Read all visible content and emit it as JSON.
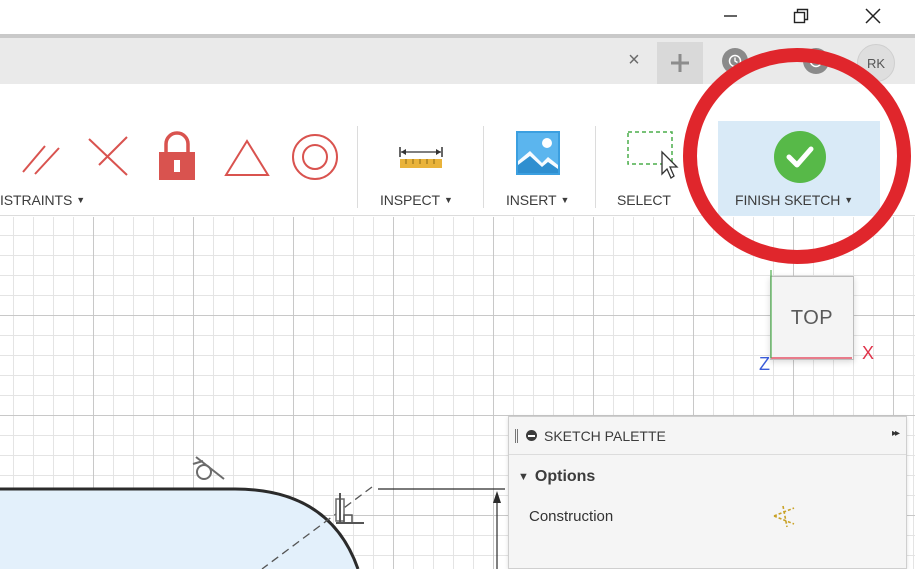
{
  "window": {
    "minimize_icon": "minimize-icon",
    "restore_icon": "restore-icon",
    "close_icon": "close-icon"
  },
  "tabs": {
    "close_glyph": "×",
    "new_tab_glyph": "+",
    "user_initials": "RK"
  },
  "toolbar": {
    "constraints_label": "ISTRAINTS",
    "inspect_label": "INSPECT",
    "insert_label": "INSERT",
    "select_label": "SELECT",
    "finish_sketch_label": "FINISH SKETCH",
    "caret": "▼"
  },
  "viewcube": {
    "face_label": "TOP",
    "x_axis": "X",
    "z_axis": "Z"
  },
  "palette": {
    "title": "SKETCH PALETTE",
    "expand_glyph": "▸▸",
    "section_title": "Options",
    "section_toggle": "▼",
    "rows": [
      {
        "label": "Construction"
      }
    ]
  },
  "colors": {
    "accent_blue": "#d9eaf7",
    "finish_green": "#57b948",
    "constraint_red": "#d9534f",
    "annotation_red": "#e0262c",
    "axis_x": "#e0334a",
    "axis_z": "#3a5bd9"
  }
}
